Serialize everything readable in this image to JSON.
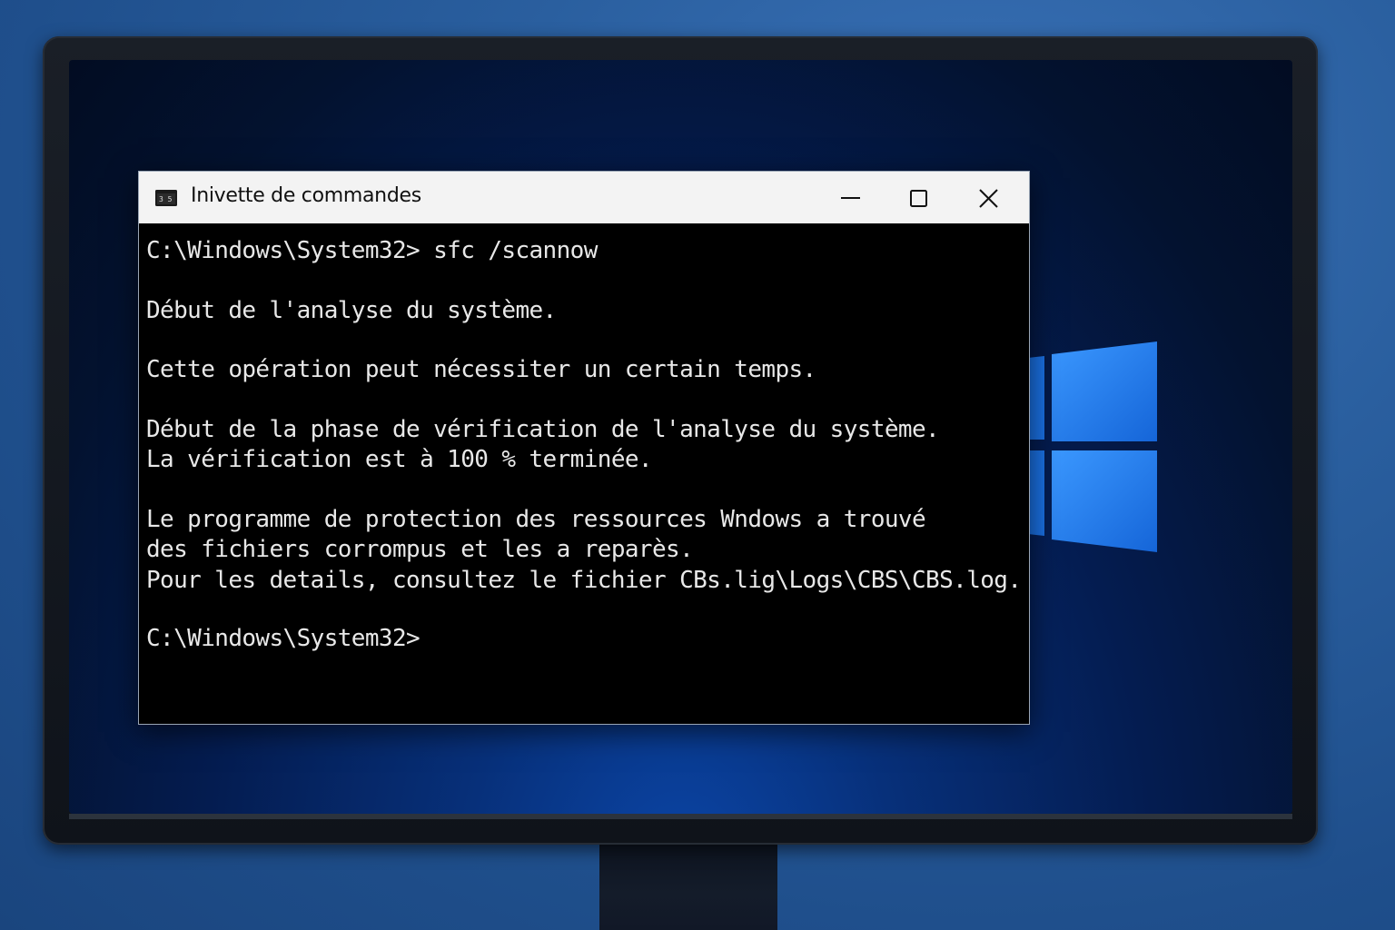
{
  "window": {
    "title": "Inivette de commandes",
    "icon": "console-app-icon"
  },
  "controls": {
    "minimize": "minimize-icon",
    "maximize": "maximize-icon",
    "close": "close-icon"
  },
  "console": {
    "lines": [
      "C:\\Windows\\System32> sfc /scannow",
      "Début de l'analyse du système.",
      "Cette opération peut nécessiter un certain temps.",
      "Début de la phase de vérification de l'analyse du système.",
      "La vérification est à 100 % terminée.",
      "Le programme de protection des ressources Wndows a trouvé",
      "des fichiers corrompus et les a reparès.",
      "Pour les details, consultez le fichier CBs.lig\\Logs\\CBS\\CBS.log.",
      "C:\\Windows\\System32>"
    ]
  },
  "colors": {
    "console_background": "#000000",
    "console_text": "#e8e8e8",
    "title_bar": "#f3f3f3",
    "windows_logo": "#1e7ef0"
  },
  "desktop": {
    "logo": "windows-logo"
  }
}
